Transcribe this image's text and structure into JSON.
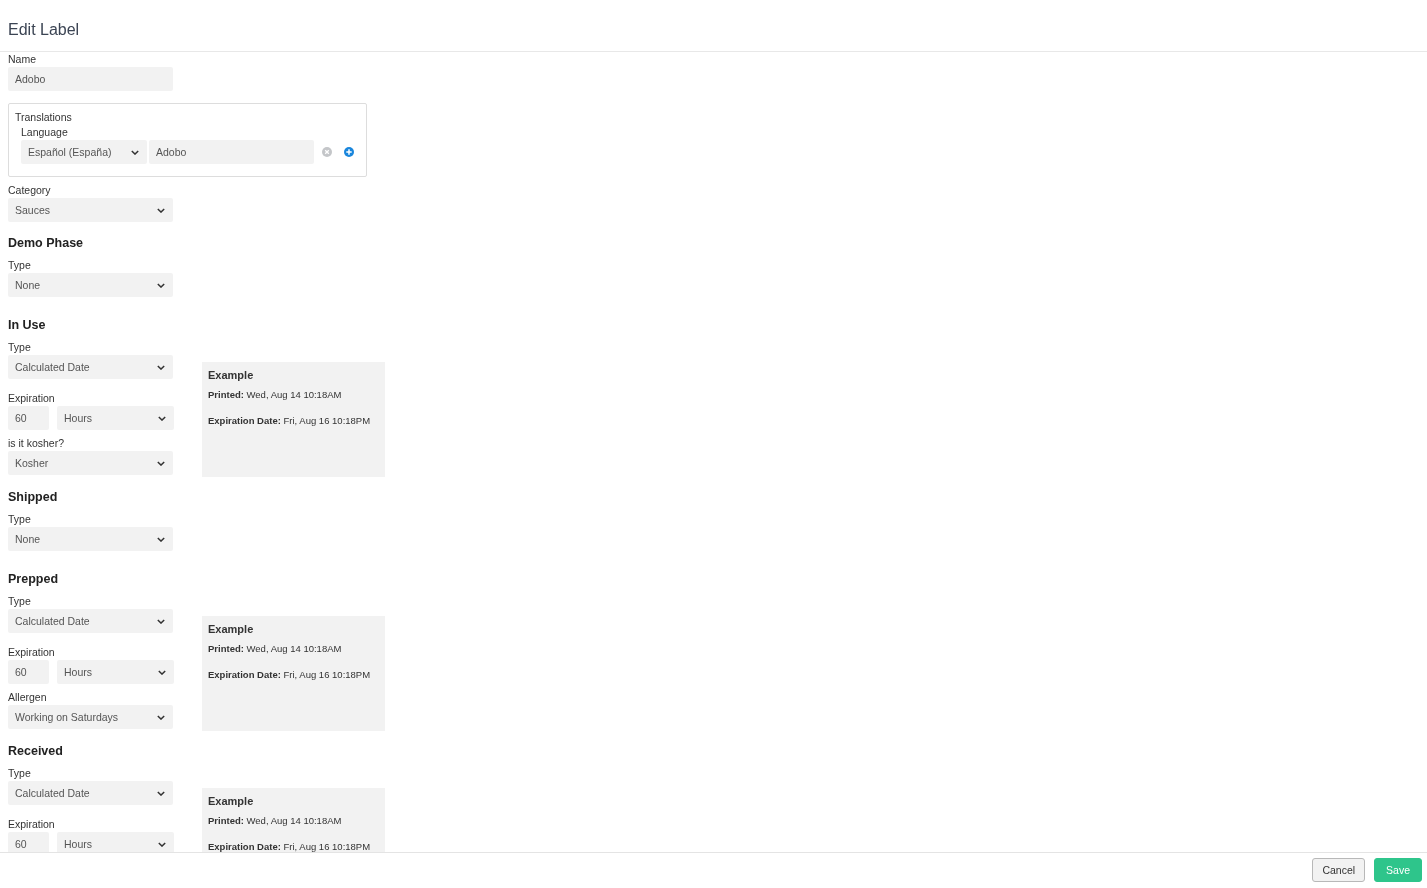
{
  "header": {
    "title": "Edit Label"
  },
  "name_field": {
    "label": "Name",
    "value": "Adobo"
  },
  "translations": {
    "title": "Translations",
    "language_label": "Language",
    "rows": [
      {
        "language": "Español (España)",
        "value": "Adobo"
      }
    ]
  },
  "category": {
    "label": "Category",
    "value": "Sauces"
  },
  "phases": [
    {
      "title": "Demo Phase",
      "fields": [
        {
          "kind": "select",
          "label": "Type",
          "value": "None"
        }
      ]
    },
    {
      "title": "In Use",
      "fields": [
        {
          "kind": "select",
          "label": "Type",
          "value": "Calculated Date"
        },
        {
          "kind": "duration",
          "label": "Expiration",
          "amount": "60",
          "unit": "Hours"
        },
        {
          "kind": "select",
          "label": "is it kosher?",
          "value": "Kosher"
        }
      ],
      "example": {
        "title": "Example",
        "lines": [
          "**Printed:** Wed, Aug 14 10:18AM",
          "**Expiration Date:** Fri, Aug 16 10:18PM"
        ]
      }
    },
    {
      "title": "Shipped",
      "fields": [
        {
          "kind": "select",
          "label": "Type",
          "value": "None"
        }
      ]
    },
    {
      "title": "Prepped",
      "fields": [
        {
          "kind": "select",
          "label": "Type",
          "value": "Calculated Date"
        },
        {
          "kind": "duration",
          "label": "Expiration",
          "amount": "60",
          "unit": "Hours"
        },
        {
          "kind": "select",
          "label": "Allergen",
          "value": "Working on Saturdays"
        }
      ],
      "example": {
        "title": "Example",
        "lines": [
          "**Printed:** Wed, Aug 14 10:18AM",
          "**Expiration Date:** Fri, Aug 16 10:18PM"
        ]
      }
    },
    {
      "title": "Received",
      "fields": [
        {
          "kind": "select",
          "label": "Type",
          "value": "Calculated Date"
        },
        {
          "kind": "duration",
          "label": "Expiration",
          "amount": "60",
          "unit": "Hours"
        }
      ],
      "example": {
        "title": "Example",
        "lines": [
          "**Printed:** Wed, Aug 14 10:18AM",
          "**Expiration Date:** Fri, Aug 16 10:18PM"
        ]
      }
    }
  ],
  "footer": {
    "buttons": [
      {
        "label": "Cancel",
        "kind": "secondary"
      },
      {
        "label": "Save",
        "kind": "primary"
      }
    ]
  }
}
